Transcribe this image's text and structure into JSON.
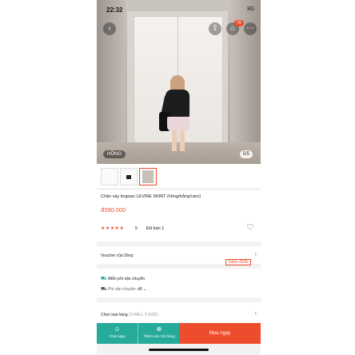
{
  "status": {
    "time": "22:32",
    "network": "3G"
  },
  "hero": {
    "color_tag": "HỒNG",
    "image_counter": "5/5",
    "cart_count": "79"
  },
  "product": {
    "name": "Chân váy tingoan LEVINE SKIRT (hồng/trắng/caro)",
    "price": "đ390.000",
    "stars": "★★★★★",
    "rating": "5",
    "sold": "Đã bán 1"
  },
  "voucher": {
    "label": "Voucher của Shop",
    "badge": "Giảm đ10k"
  },
  "shipping": {
    "free": "Miễn phí vận chuyển",
    "fee_label": "Phí vận chuyển:",
    "fee_value": "đ0"
  },
  "variants": {
    "label": "Chọn loại hàng",
    "detail": "(3 MÀU, 3 SIZE)"
  },
  "bottom": {
    "chat": "Chat ngay",
    "add_cart": "Thêm vào Giỏ hàng",
    "buy": "Mua ngay"
  },
  "colors": {
    "accent": "#ee4d2d",
    "teal": "#26aa99"
  }
}
